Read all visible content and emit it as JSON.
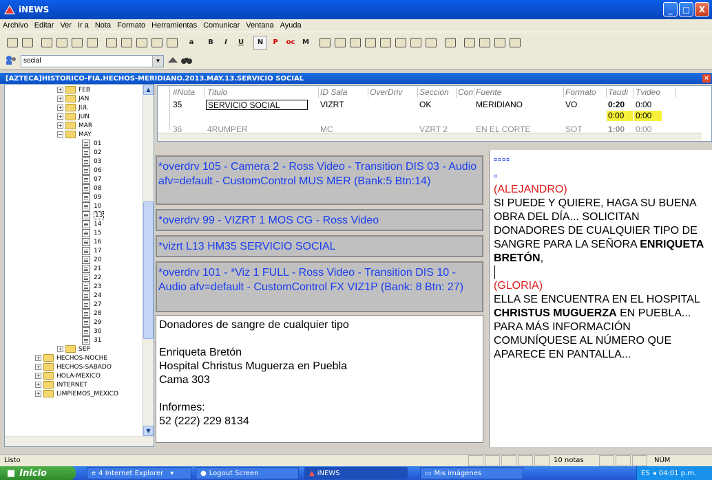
{
  "window": {
    "title": "iNEWS",
    "controls": [
      "_",
      "□",
      "X"
    ]
  },
  "menu": [
    "Archivo",
    "Editar",
    "Ver",
    "Ir a",
    "Nota",
    "Formato",
    "Herramientas",
    "Comunicar",
    "Ventana",
    "Ayuda"
  ],
  "toolbar": {
    "format_buttons": [
      "a",
      "B",
      "I",
      "U",
      "N",
      "P",
      "oc",
      "M"
    ]
  },
  "search": {
    "value": "social"
  },
  "story_path": "[AZTECA]HISTORICO-FIA.HECHOS-MERIDIANO.2013.MAY.13.SERVICIO SOCIAL",
  "tree": {
    "months": [
      "FEB",
      "JAN",
      "JUL",
      "JUN",
      "MAR"
    ],
    "open_month": "MAY",
    "days": [
      "01",
      "02",
      "03",
      "06",
      "07",
      "08",
      "09",
      "10",
      "13",
      "14",
      "15",
      "16",
      "17",
      "20",
      "21",
      "22",
      "23",
      "24",
      "27",
      "28",
      "29",
      "30",
      "31"
    ],
    "selected_day": "13",
    "after": [
      "SEP"
    ],
    "folders": [
      "HECHOS-NOCHE",
      "HECHOS-SABADO",
      "HOLA-MEXICO",
      "INTERNET",
      "LIMPIEMOS_MEXICO"
    ]
  },
  "grid": {
    "headers": [
      "#Nota",
      "Titulo",
      "ID Sala",
      "OverDriv",
      "Seccion",
      "Con",
      "Fuente",
      "Formato",
      "Taudi",
      "Tvideo"
    ],
    "rows": [
      {
        "nota": "35",
        "titulo": "SERVICIO SOCIAL",
        "id_sala": "VIZRT",
        "seccion": "OK",
        "fuente": "MERIDIANO",
        "formato": "VO",
        "taudi": "0:20",
        "tvideo": "0:00"
      },
      {
        "taudi": "0:00",
        "tvideo": "0:00"
      },
      {
        "nota": "36",
        "titulo": "4RUMPER",
        "id_sala": "MC",
        "seccion": "VZRT 2",
        "fuente": "EN EL CORTE",
        "formato": "SOT",
        "taudi": "1:00",
        "tvideo": "0:00"
      }
    ]
  },
  "production_cues": [
    "*overdrv 105 - Camera 2 - Ross Video - Transition DIS 03 - Audio afv=default - CustomControl MUS MER (Bank:5 Btn:14)",
    "*overdrv 99 - VIZRT 1 MOS CG - Ross Video",
    "*vizrt L13 HM35 SERVICIO SOCIAL",
    "*overdrv 101 - *Viz 1 FULL - Ross Video - Transition DIS 10 - Audio afv=default - CustomControl FX VIZ1P (Bank: 8 Btn: 27)"
  ],
  "story_text": {
    "line1": "Donadores de sangre de cualquier tipo",
    "line2": "Enriqueta Bretón",
    "line3": "Hospital Christus Muguerza en Puebla",
    "line4": "Cama 303",
    "line5": "Informes:",
    "line6": "52 (222) 229 8134"
  },
  "script": {
    "marks1": "¤¤¤¤",
    "marks2": "¤",
    "speaker1": "(ALEJANDRO)",
    "p1a": "SI PUEDE Y QUIERE, HAGA SU BUENA OBRA DEL DÍA... SOLICITAN DONADORES DE CUALQUIER TIPO DE SANGRE PARA LA SEÑORA ",
    "p1b": "ENRIQUETA BRETÓN",
    "p1c": ",",
    "speaker2": "(GLORIA)",
    "p2a": "ELLA SE ENCUENTRA EN EL HOSPITAL ",
    "p2b": "CHRISTUS MUGUERZA",
    "p2c": " EN PUEBLA... PARA MÁS INFORMACIÓN COMUNÍQUESE AL NÚMERO QUE APARECE EN PANTALLA..."
  },
  "status": {
    "left": "Listo",
    "notes": "10 notas",
    "num": "NÚM"
  },
  "taskbar": {
    "start": "Inicio",
    "tasks": [
      "4 Internet Explorer",
      "Logout Screen",
      "iNEWS",
      "Mis imágenes"
    ],
    "lang": "ES",
    "clock": "04:01 p.m."
  },
  "colors": {
    "cue_text": "#1a3df0",
    "speaker": "#e01a1a",
    "highlight": "#f7f03a",
    "titlebar": "#0a52d6"
  }
}
